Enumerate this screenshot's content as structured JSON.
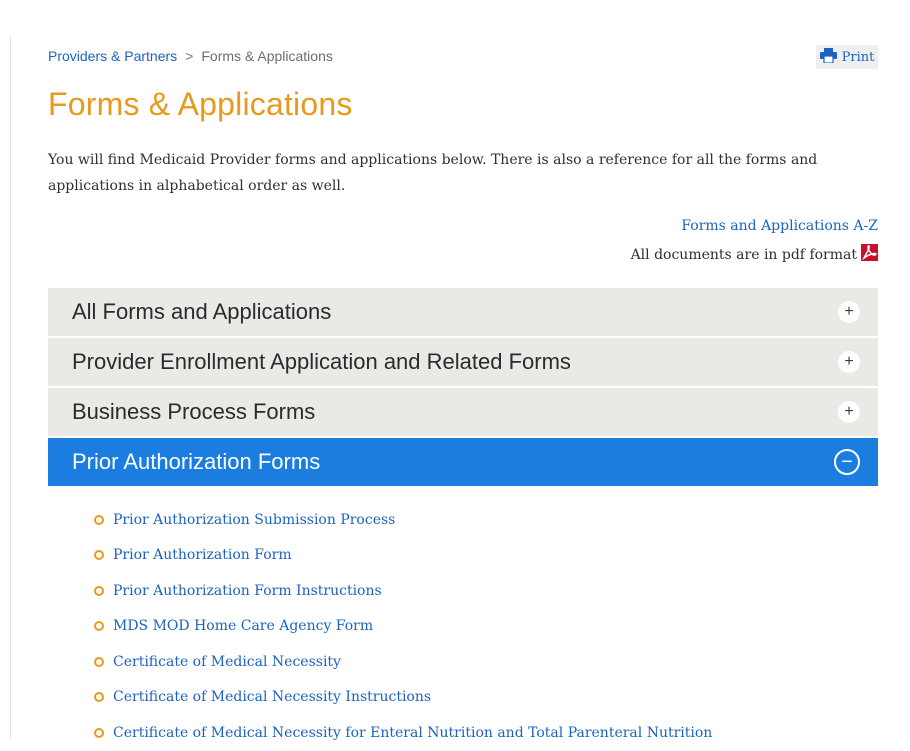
{
  "breadcrumb": {
    "parent": "Providers & Partners",
    "separator": ">",
    "current": "Forms & Applications"
  },
  "print": {
    "label": "Print",
    "icon": "printer-icon"
  },
  "page": {
    "title": "Forms & Applications",
    "intro": "You will find Medicaid Provider forms and applications below. There is also a reference for all the forms and applications in alphabetical order as well."
  },
  "links": {
    "az": "Forms and Applications A-Z",
    "pdf_note": "All documents are in pdf format",
    "pdf_icon": "pdf-icon"
  },
  "accordion": {
    "sections": [
      {
        "label": "All Forms and Applications",
        "expanded": false
      },
      {
        "label": "Provider Enrollment Application and Related Forms",
        "expanded": false
      },
      {
        "label": "Business Process Forms",
        "expanded": false
      },
      {
        "label": "Prior Authorization Forms",
        "expanded": true
      }
    ],
    "items": [
      "Prior Authorization Submission Process",
      "Prior Authorization Form",
      "Prior Authorization Form Instructions",
      "MDS MOD Home Care Agency Form",
      "Certificate of Medical Necessity",
      "Certificate of Medical Necessity Instructions",
      "Certificate of Medical Necessity for Enteral Nutrition and Total Parenteral Nutrition"
    ]
  },
  "colors": {
    "title": "#e89a1c",
    "link": "#1c63c0",
    "active_header": "#1b7de0",
    "header_bg": "#ebe9e6"
  }
}
